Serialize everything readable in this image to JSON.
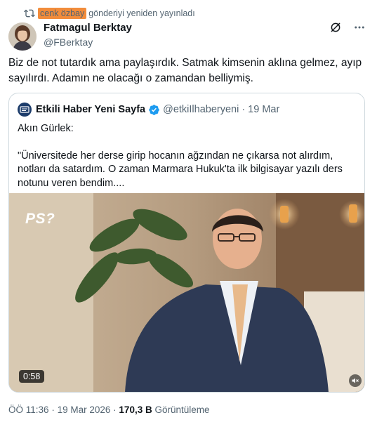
{
  "repost": {
    "icon": "repost-icon",
    "name": "cenk özbay",
    "text": "gönderiyi yeniden yayınladı"
  },
  "author": {
    "name": "Fatmagul Berktay",
    "handle": "@FBerktay"
  },
  "tweet": {
    "text": "Biz de not tutardık ama paylaşırdık. Satmak kimsenin aklına gelmez, ayıp sayılırdı. Adamın ne olacağı o zamandan belliymiş."
  },
  "quote": {
    "name": "Etkili Haber Yeni Sayfa",
    "handle": "@etkiIlhaberyeni",
    "separator": "·",
    "date": "19 Mar",
    "body_line1": "Akın Gürlek:",
    "body_line2": "\"Üniversitede her derse girip hocanın ağzından ne çıkarsa not alırdım, notları da satardım. O zaman Marmara Hukuk'ta ilk bilgisayar yazılı ders notunu veren bendim....",
    "video": {
      "logo": "PS?",
      "duration": "0:58"
    }
  },
  "meta": {
    "time": "ÖÖ 11:36",
    "sep1": "·",
    "date": "19 Mar 2026",
    "sep2": "·",
    "views_count": "170,3 B",
    "views_label": "Görüntüleme"
  },
  "colors": {
    "accent": "#1d9bf0",
    "secondary_text": "#536471",
    "highlight": "#f28c3b"
  }
}
